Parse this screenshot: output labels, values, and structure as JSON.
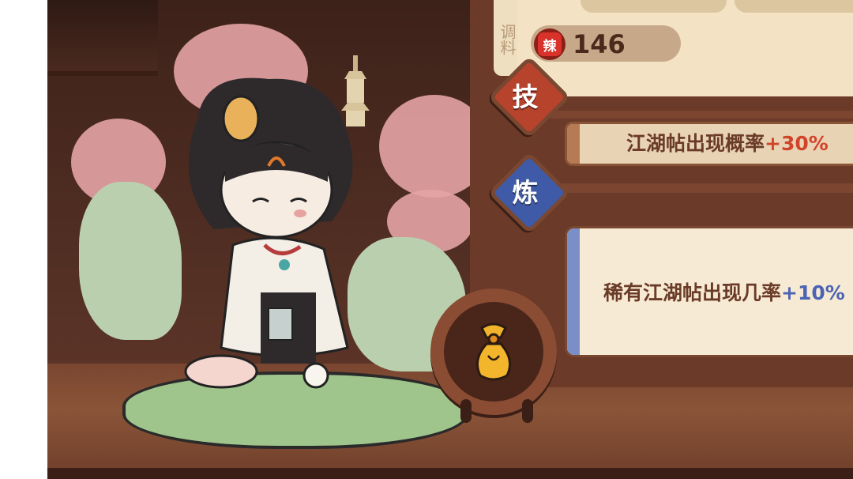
{
  "panel": {
    "side_label": "调料",
    "spice_badge": "辣",
    "spice_value": "146"
  },
  "tabs": {
    "skill": "技",
    "refine": "炼"
  },
  "bonus": {
    "text": "江湖帖出现概率",
    "value": "+30%"
  },
  "rare_bonus": {
    "text": "稀有江湖帖出现几率",
    "value": "+10%"
  },
  "colors": {
    "skill_tab": "#b8432d",
    "refine_tab": "#3f5aa6",
    "accent_red": "#d2442a",
    "accent_blue": "#4c63b3"
  },
  "icons": {
    "spice": "spice-icon",
    "medal": "pouch-icon"
  }
}
